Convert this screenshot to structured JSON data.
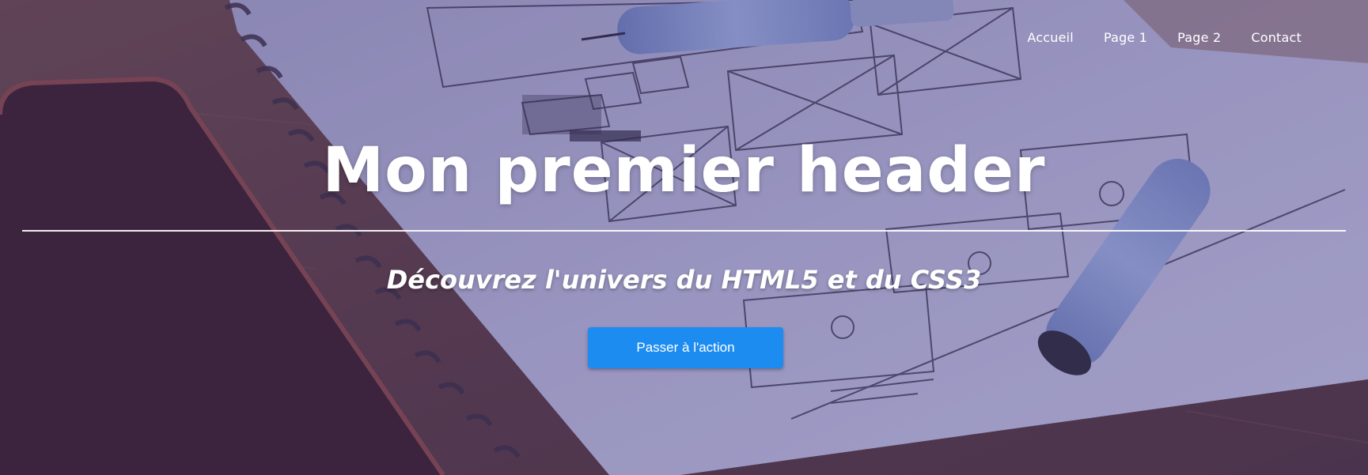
{
  "nav": {
    "items": [
      {
        "label": "Accueil"
      },
      {
        "label": "Page 1"
      },
      {
        "label": "Page 2"
      },
      {
        "label": "Contact"
      }
    ]
  },
  "hero": {
    "title": "Mon premier header",
    "subtitle": "Découvrez l'univers du HTML5 et du CSS3",
    "cta_label": "Passer à l'action"
  },
  "colors": {
    "cta": "#1d8cf0",
    "text": "#ffffff",
    "overlay": "#463270"
  }
}
